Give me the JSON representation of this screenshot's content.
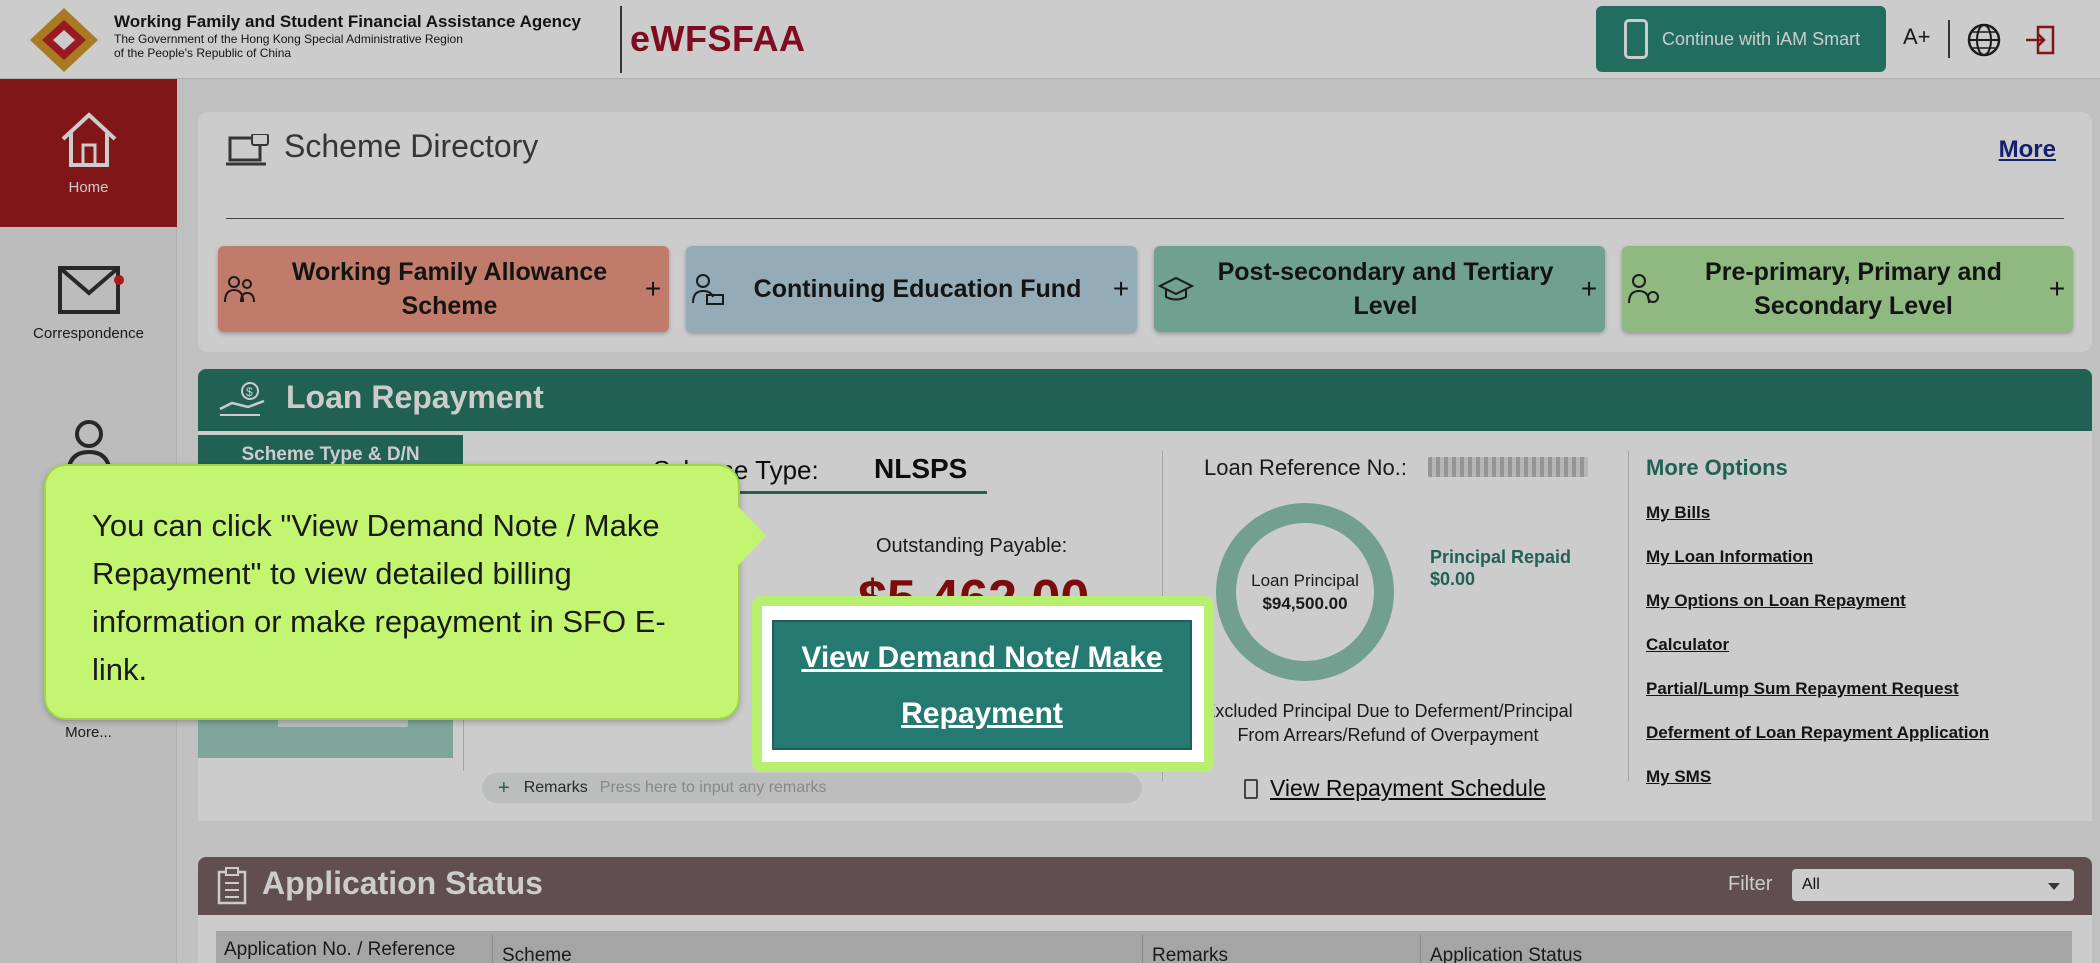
{
  "header": {
    "agency_name": "Working Family and Student Financial Assistance Agency",
    "agency_sub1": "The Government of the Hong Kong Special Administrative Region",
    "agency_sub2": "of the People's Republic of China",
    "brand": "eWFSFAA",
    "iam_smart_label": "Continue with iAM Smart",
    "font_size_label": "A+"
  },
  "sidebar": {
    "items": [
      {
        "label": "Home"
      },
      {
        "label": "Correspondence"
      },
      {
        "label": ""
      },
      {
        "label": "More..."
      }
    ]
  },
  "scheme_directory": {
    "title": "Scheme Directory",
    "more_label": "More",
    "tiles": [
      {
        "label": "Working Family Allowance Scheme",
        "color": "#f09a86"
      },
      {
        "label": "Continuing Education Fund",
        "color": "#b9d6e6"
      },
      {
        "label": "Post-secondary and Tertiary Level",
        "color": "#8cc8b3"
      },
      {
        "label": "Pre-primary, Primary and Secondary Level",
        "color": "#b3e8a0"
      }
    ],
    "plus": "+"
  },
  "loan_repayment": {
    "title": "Loan Repayment",
    "scheme_tab": "Scheme Type & D/N",
    "scheme_type_label": "Scheme Type:",
    "scheme_type_value": "NLSPS",
    "outstanding_label": "Outstanding Payable:",
    "outstanding_value": "$5,462.00",
    "remarks_label": "Remarks",
    "remarks_placeholder": "Press here to input any remarks",
    "loan_ref_label": "Loan Reference No.:",
    "donut_label": "Loan Principal",
    "donut_value": "$94,500.00",
    "principal_repaid_label": "Principal Repaid",
    "principal_repaid_value": "$0.00",
    "excluded_note": "Excluded Principal Due to Deferment/Principal From Arrears/Refund of Overpayment",
    "view_schedule": "View Repayment Schedule",
    "more_options_title": "More Options",
    "more_options": [
      "My Bills",
      "My Loan Information",
      "My Options on Loan Repayment",
      "Calculator",
      "Partial/Lump Sum Repayment Request",
      "Deferment of Loan Repayment Application",
      "My SMS"
    ],
    "view_demand_note_button": "View Demand Note/ Make Repayment"
  },
  "application_status": {
    "title": "Application Status",
    "filter_label": "Filter",
    "filter_value": "All",
    "columns": [
      "Application No. / Reference",
      "Scheme",
      "Remarks",
      "Application Status"
    ]
  },
  "tutorial": {
    "callout_text": "You can click \"View Demand Note / Make Repayment\" to view detailed billing information or make repayment in SFO E-link."
  },
  "colors": {
    "brand_red": "#a0102a",
    "accent_teal": "#2a7a6a",
    "status_brown": "#7a6262",
    "callout_green": "#c4f570"
  }
}
